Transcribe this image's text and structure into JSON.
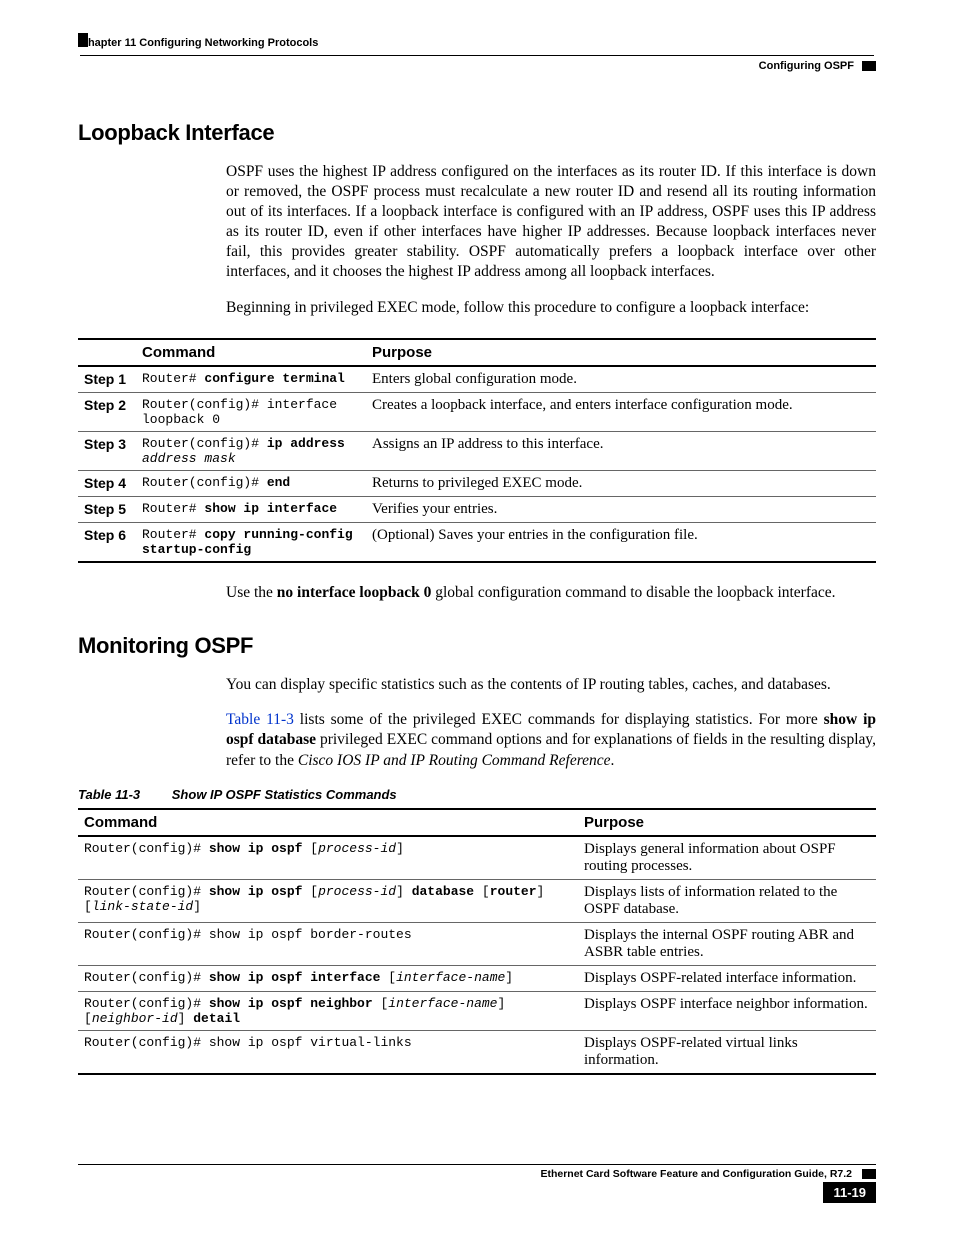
{
  "header": {
    "left": "Chapter 11 Configuring Networking Protocols",
    "right": "Configuring OSPF"
  },
  "sections": {
    "loopback": {
      "title": "Loopback Interface",
      "p1": "OSPF uses the highest IP address configured on the interfaces as its router ID. If this interface is down or removed, the OSPF process must recalculate a new router ID and resend all its routing information out of its interfaces. If a loopback interface is configured with an IP address, OSPF uses this IP address as its router ID, even if other interfaces have higher IP addresses. Because loopback interfaces never fail, this provides greater stability. OSPF automatically prefers a loopback interface over other interfaces, and it chooses the highest IP address among all loopback interfaces.",
      "p2": "Beginning in privileged EXEC mode, follow this procedure to configure a loopback interface:",
      "table": {
        "headers": {
          "cmd": "Command",
          "purpose": "Purpose"
        },
        "rows": [
          {
            "step": "Step 1",
            "prefix": "Router# ",
            "bold": "configure terminal",
            "suffix": "",
            "ital": "",
            "purpose": "Enters global configuration mode."
          },
          {
            "step": "Step 2",
            "prefix": "Router(config)# interface loopback 0",
            "bold": "",
            "suffix": "",
            "ital": "",
            "purpose": "Creates a loopback interface, and enters interface configuration mode."
          },
          {
            "step": "Step 3",
            "prefix": "Router(config)# ",
            "bold": "ip address",
            "suffix": " ",
            "ital": "address mask",
            "purpose": "Assigns an IP address to this interface."
          },
          {
            "step": "Step 4",
            "prefix": "Router(config)# ",
            "bold": "end",
            "suffix": "",
            "ital": "",
            "purpose": "Returns to privileged EXEC mode."
          },
          {
            "step": "Step 5",
            "prefix": "Router# ",
            "bold": "show ip interface",
            "suffix": "",
            "ital": "",
            "purpose": "Verifies your entries."
          },
          {
            "step": "Step 6",
            "prefix": "Router# ",
            "bold": "copy running-config startup-config",
            "suffix": "",
            "ital": "",
            "purpose": "(Optional) Saves your entries in the configuration file."
          }
        ]
      },
      "note_pre": "Use the ",
      "note_bold": "no interface loopback 0",
      "note_post": " global configuration command to disable the loopback interface."
    },
    "monitoring": {
      "title": "Monitoring OSPF",
      "p1": "You can display specific statistics such as the contents of IP routing tables, caches, and databases.",
      "p2_link": "Table 11-3",
      "p2_mid": " lists some of the privileged EXEC commands for displaying statistics. For more ",
      "p2_bold": "show ip ospf database",
      "p2_after": " privileged EXEC command options and for explanations of fields in the resulting display, refer to the ",
      "p2_ital": "Cisco IOS IP and IP Routing Command Reference",
      "p2_end": ".",
      "caption_num": "Table 11-3",
      "caption_title": "Show IP OSPF Statistics Commands",
      "table": {
        "headers": {
          "cmd": "Command",
          "purpose": "Purpose"
        },
        "rows": [
          {
            "prefix": "Router(config)# ",
            "bold": "show ip ospf",
            "suffix": " [",
            "ital": "process-id",
            "tail": "]",
            "purpose": "Displays general information about OSPF routing processes."
          },
          {
            "prefix": "Router(config)# ",
            "bold": "show ip ospf",
            "suffix": " [",
            "ital": "process-id",
            "mid1": "] ",
            "bold2": "database",
            "mid2": " [",
            "bold3": "router",
            "mid3": "] [",
            "ital2": "link-state-id",
            "tail": "]",
            "purpose": "Displays lists of information related to the OSPF database."
          },
          {
            "prefix": "Router(config)# show ip ospf border-routes",
            "bold": "",
            "suffix": "",
            "ital": "",
            "tail": "",
            "purpose": "Displays the internal OSPF routing ABR and ASBR table entries."
          },
          {
            "prefix": "Router(config)# ",
            "bold": "show ip ospf interface",
            "suffix": " [",
            "ital": "interface-name",
            "tail": "]",
            "purpose": "Displays OSPF-related interface information."
          },
          {
            "prefix": "Router(config)# ",
            "bold": "show ip ospf neighbor",
            "suffix": " [",
            "ital": "interface-name",
            "mid1": "] [",
            "ital2": "neighbor-id",
            "mid2": "] ",
            "bold2": "detail",
            "tail": "",
            "purpose": "Displays OSPF interface neighbor information."
          },
          {
            "prefix": "Router(config)# show ip ospf virtual-links",
            "bold": "",
            "suffix": "",
            "ital": "",
            "tail": "",
            "purpose": "Displays OSPF-related virtual links information."
          }
        ]
      }
    }
  },
  "footer": {
    "title": "Ethernet Card Software Feature and Configuration Guide, R7.2",
    "page": "11-19"
  }
}
